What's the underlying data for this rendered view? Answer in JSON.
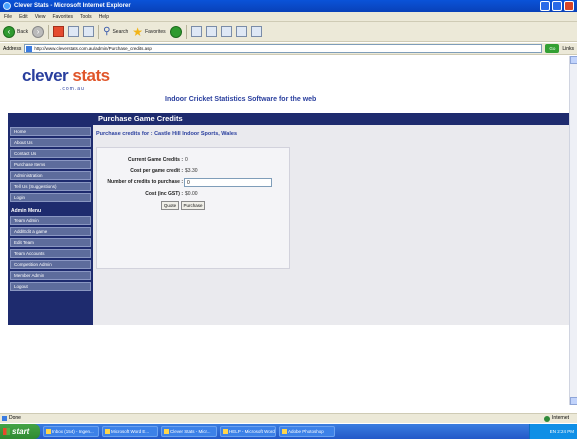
{
  "window": {
    "title": "Clever Stats - Microsoft Internet Explorer"
  },
  "menu": [
    "File",
    "Edit",
    "View",
    "Favorites",
    "Tools",
    "Help"
  ],
  "toolbar": {
    "back": "Back",
    "search": "Search",
    "favorites": "Favorites"
  },
  "address": {
    "label": "Address",
    "url": "http://www.cleverstats.com.au/admin/Purchase_credits.asp",
    "go": "Go",
    "links": "Links"
  },
  "site": {
    "logo_main": "clever",
    "logo_accent": "stats",
    "logo_sub": ".com.au",
    "tagline": "Indoor Cricket Statistics Software for the web",
    "banner": "Purchase Game Credits"
  },
  "sidebar": {
    "items": [
      "Home",
      "About Us",
      "Contact Us",
      "Purchase Items",
      "Administration",
      "Tell Us (Suggestions)",
      "Login"
    ],
    "admin_heading": "Admin Menu",
    "admin_items": [
      "Team Admin",
      "Add/Edit a game",
      "Edit Team",
      "Team Accounts",
      "Competition Admin",
      "Member Admin",
      "Logout"
    ]
  },
  "content": {
    "title": "Purchase credits for : Castle Hill Indoor Sports, Wales",
    "current_label": "Current Game Credits :",
    "current_value": "0",
    "cost_label": "Cost per game credit :",
    "cost_value": "$3.30",
    "qty_label": "Number of credits to purchase :",
    "qty_value": "0",
    "total_label": "Cost (inc GST) :",
    "total_value": "$0.00",
    "quote_label": "Quote",
    "purchase_label": "Purchase"
  },
  "status": {
    "text": "Done",
    "zone": "Internet"
  },
  "taskbar": {
    "start": "start",
    "tasks": [
      "Inbox (154) - Ingen...",
      "Microsoft Word E...",
      "Clever Stats - Micr...",
      "HELP - Microsoft Word",
      "Adobe Photoshop"
    ],
    "clock": "EN  2:24 PM"
  }
}
